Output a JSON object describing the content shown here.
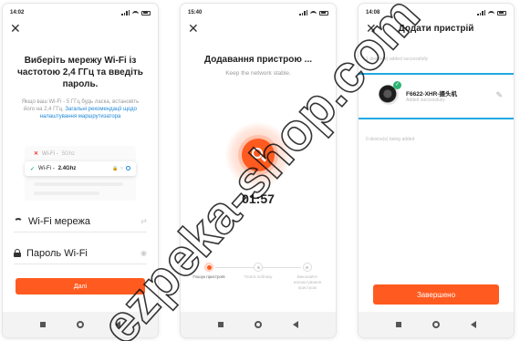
{
  "watermark": "ezpeka-shop.com",
  "screen1": {
    "status_time": "14:02",
    "title": "Виберіть мережу Wi-Fi із частотою 2,4 ГГц та введіть пароль.",
    "desc": "Якщо ваш Wi-Fi - 5 ГГц будь ласка, встановіть його на 2,4 ГГц.",
    "desc_link": "Загальні рекомендації щодо налаштування маршрутизатора",
    "wifi_bad_prefix": "Wi-Fi -",
    "wifi_bad_freq": "5Ghz",
    "wifi_good_prefix": "Wi-Fi -",
    "wifi_good_freq": "2.4Ghz",
    "wifi_field_label": "Wi-Fi мережа",
    "password_field_label": "Пароль Wi-Fi",
    "next_button": "Далі"
  },
  "screen2": {
    "status_time": "15:40",
    "title": "Додавання пристрою ...",
    "subtitle": "Keep the network stable.",
    "timer": "01:57",
    "steps": [
      {
        "label": "Пошук пристроїв",
        "active": true
      },
      {
        "label": "Плата поблизу",
        "active": false
      },
      {
        "label": "Виконайте налаштування пристрою",
        "active": false
      }
    ]
  },
  "screen3": {
    "status_time": "14:08",
    "title": "Додати пристрій",
    "added_count": "1 device(s) added successfully",
    "device_name": "F6622-XHR-摄头机",
    "device_status": "Added successfully",
    "adding_count": "0 device(s) being added",
    "done_button": "Завершено"
  },
  "colors": {
    "accent": "#ff5a1f",
    "link": "#1e88d8",
    "success": "#2bb673",
    "highlight": "#21a9e1"
  }
}
